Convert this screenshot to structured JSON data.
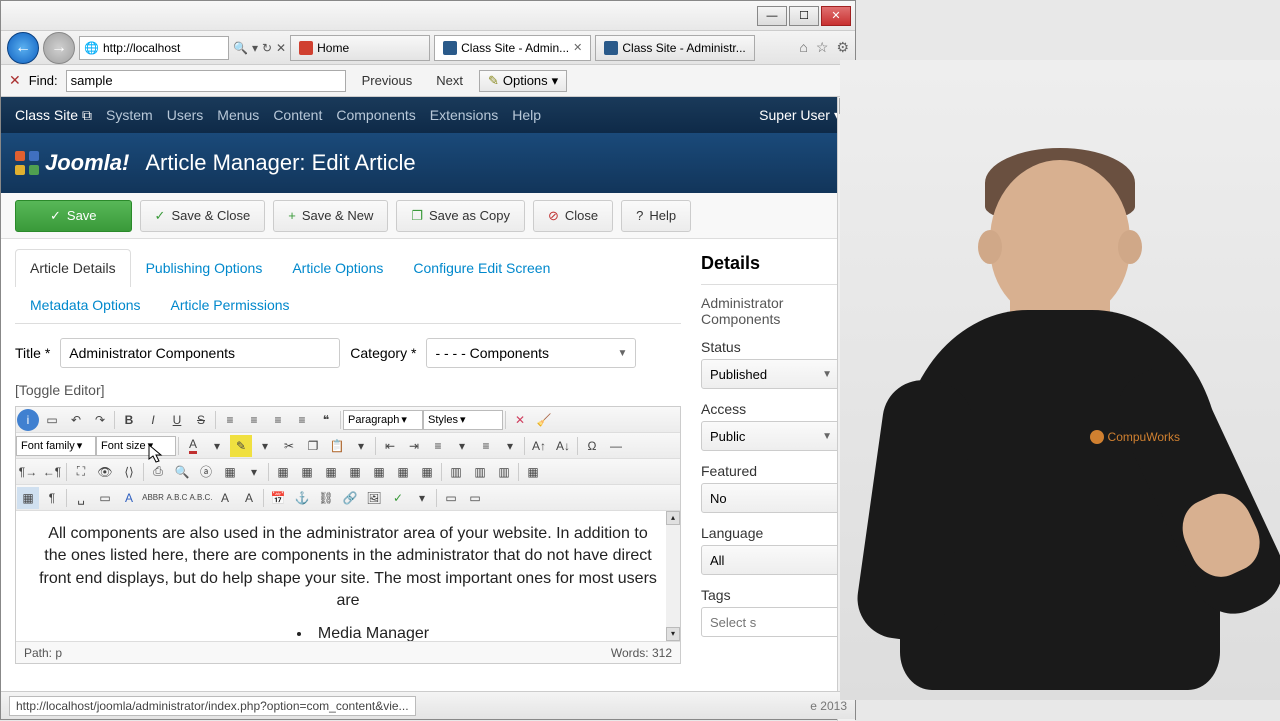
{
  "window": {
    "min": "—",
    "max": "☐",
    "close": "✕"
  },
  "browser": {
    "url": "http://localhost",
    "tabs": [
      {
        "label": "Home",
        "active": false
      },
      {
        "label": "Class Site - Admin...",
        "active": true
      },
      {
        "label": "Class Site - Administr...",
        "active": false
      }
    ],
    "find": {
      "label": "Find:",
      "value": "sample",
      "prev": "Previous",
      "next": "Next",
      "options": "Options"
    }
  },
  "joomla": {
    "site_name": "Class Site",
    "menus": [
      "System",
      "Users",
      "Menus",
      "Content",
      "Components",
      "Extensions",
      "Help"
    ],
    "user": "Super User",
    "logo_text": "Joomla!",
    "page_title": "Article Manager: Edit Article"
  },
  "actions": {
    "save": "Save",
    "save_close": "Save & Close",
    "save_new": "Save & New",
    "save_copy": "Save as Copy",
    "close": "Close",
    "help": "Help"
  },
  "tabs": [
    "Article Details",
    "Publishing Options",
    "Article Options",
    "Configure Edit Screen",
    "Metadata Options",
    "Article Permissions"
  ],
  "form": {
    "title_label": "Title *",
    "title_value": "Administrator Components",
    "category_label": "Category *",
    "category_value": "- - - - Components",
    "toggle_editor": "[Toggle Editor]"
  },
  "editor": {
    "font_family": "Font family",
    "font_size": "Font size",
    "paragraph": "Paragraph",
    "styles": "Styles",
    "body_text": "All components are also used in the administrator area of your website. In addition to the ones listed here, there are components in the administrator that do not have direct front end displays, but do help shape your site. The most important ones for most users are",
    "list_item": "Media Manager",
    "path_label": "Path:",
    "path_value": "p",
    "words_label": "Words:",
    "words_value": "312"
  },
  "details": {
    "heading": "Details",
    "article_name": "Administrator Components",
    "status_label": "Status",
    "status_value": "Published",
    "access_label": "Access",
    "access_value": "Public",
    "featured_label": "Featured",
    "featured_value": "No",
    "language_label": "Language",
    "language_value": "All",
    "tags_label": "Tags",
    "tags_placeholder": "Select s"
  },
  "statusbar": {
    "url": "http://localhost/joomla/administrator/index.php?option=com_content&vie...",
    "date_fragment": "e 2013"
  },
  "presenter_logo": "CompuWorks"
}
